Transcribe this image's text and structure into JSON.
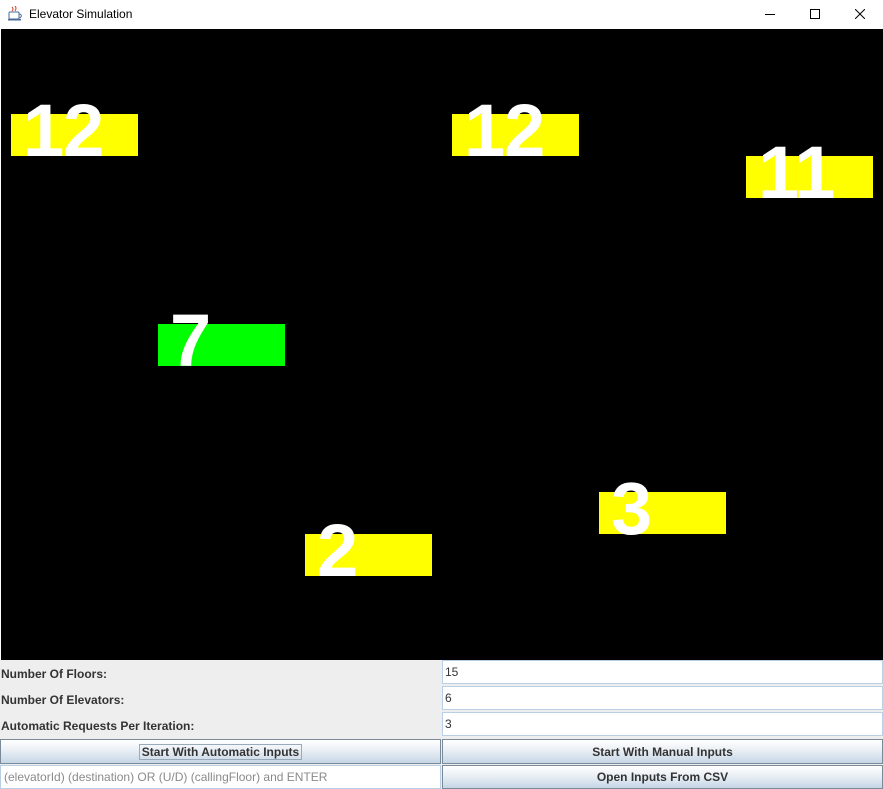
{
  "window": {
    "title": "Elevator Simulation",
    "icon": "java-cup-icon",
    "controls": [
      "minimize-icon",
      "maximize-icon",
      "close-icon"
    ]
  },
  "colors": {
    "canvas_background": "#000000",
    "elevator_idle": "#ffff00",
    "elevator_active": "#00ff00",
    "floor_number": "#ffffff"
  },
  "elevators": [
    {
      "floor": "12",
      "color": "#ffff00"
    },
    {
      "floor": "7",
      "color": "#00ff00"
    },
    {
      "floor": "2",
      "color": "#ffff00"
    },
    {
      "floor": "12",
      "color": "#ffff00"
    },
    {
      "floor": "3",
      "color": "#ffff00"
    },
    {
      "floor": "11",
      "color": "#ffff00"
    }
  ],
  "settings": {
    "floors_label": "Number Of Floors:",
    "floors_value": "15",
    "elevators_label": "Number Of Elevators:",
    "elevators_value": "6",
    "requests_label": "Automatic Requests Per Iteration:",
    "requests_value": "3"
  },
  "buttons": {
    "automatic": "Start With Automatic Inputs",
    "manual": "Start With Manual Inputs",
    "csv": "Open Inputs From CSV"
  },
  "command": {
    "placeholder": "(elevatorId) (destination) OR (U/D) (callingFloor) and ENTER"
  }
}
